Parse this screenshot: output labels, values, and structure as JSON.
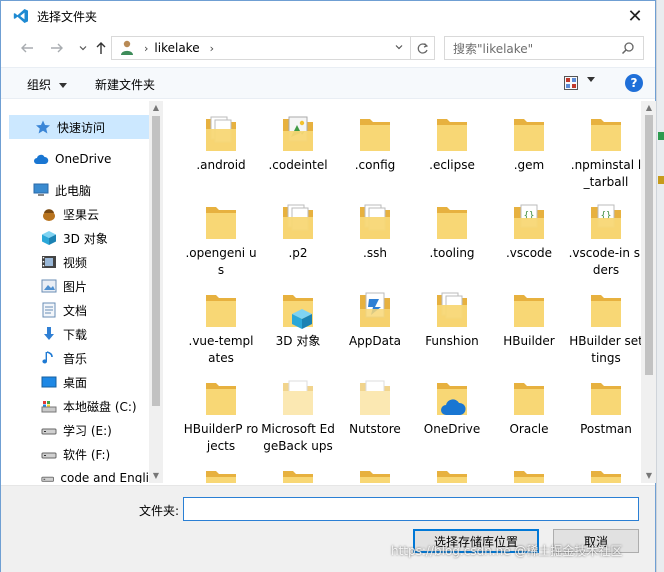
{
  "window": {
    "title": "选择文件夹",
    "close_glyph": "✕"
  },
  "address_bar": {
    "path_segment": "likelake",
    "search_placeholder": "搜索\"likelake\""
  },
  "toolbar": {
    "organize_label": "组织",
    "new_folder_label": "新建文件夹",
    "help_label": "?"
  },
  "nav_pane": {
    "items": [
      {
        "label": "快速访问",
        "icon": "star-icon"
      },
      {
        "label": "OneDrive",
        "icon": "cloud-icon"
      },
      {
        "label": "此电脑",
        "icon": "computer-icon"
      },
      {
        "label": "坚果云",
        "icon": "nut-icon"
      },
      {
        "label": "3D 对象",
        "icon": "cube-icon"
      },
      {
        "label": "视频",
        "icon": "video-icon"
      },
      {
        "label": "图片",
        "icon": "pictures-icon"
      },
      {
        "label": "文档",
        "icon": "document-icon"
      },
      {
        "label": "下载",
        "icon": "download-icon"
      },
      {
        "label": "音乐",
        "icon": "music-icon"
      },
      {
        "label": "桌面",
        "icon": "desktop-icon"
      },
      {
        "label": "本地磁盘 (C:)",
        "icon": "disk-icon"
      },
      {
        "label": "学习 (E:)",
        "icon": "drive-icon"
      },
      {
        "label": "软件 (F:)",
        "icon": "drive-icon"
      },
      {
        "label": "code and Engli",
        "icon": "drive-icon"
      }
    ]
  },
  "folders": [
    {
      "label": ".android",
      "icon": "folder-docs-icon"
    },
    {
      "label": ".codeintel",
      "icon": "folder-image-icon"
    },
    {
      "label": ".config",
      "icon": "folder-icon"
    },
    {
      "label": ".eclipse",
      "icon": "folder-icon"
    },
    {
      "label": ".gem",
      "icon": "folder-icon"
    },
    {
      "label": ".npminstal l_tarball",
      "icon": "folder-icon"
    },
    {
      "label": ".opengeni us",
      "icon": "folder-icon"
    },
    {
      "label": ".p2",
      "icon": "folder-docs-icon"
    },
    {
      "label": ".ssh",
      "icon": "folder-docs-icon"
    },
    {
      "label": ".tooling",
      "icon": "folder-icon"
    },
    {
      "label": ".vscode",
      "icon": "folder-code-icon"
    },
    {
      "label": ".vscode-in siders",
      "icon": "folder-code-icon"
    },
    {
      "label": ".vue-templ ates",
      "icon": "folder-icon"
    },
    {
      "label": "3D 对象",
      "icon": "folder-3d-icon"
    },
    {
      "label": "AppData",
      "icon": "folder-appdata-icon"
    },
    {
      "label": "Funshion",
      "icon": "folder-docs-icon"
    },
    {
      "label": "HBuilder",
      "icon": "folder-icon"
    },
    {
      "label": "HBuilder settings",
      "icon": "folder-icon"
    },
    {
      "label": "HBuilderP rojects",
      "icon": "folder-icon"
    },
    {
      "label": "Microsoft EdgeBack ups",
      "icon": "folder-light-icon"
    },
    {
      "label": "Nutstore",
      "icon": "folder-light-icon"
    },
    {
      "label": "OneDrive",
      "icon": "folder-onedrive-icon"
    },
    {
      "label": "Oracle",
      "icon": "folder-icon"
    },
    {
      "label": "Postman",
      "icon": "folder-icon"
    }
  ],
  "footer": {
    "folder_label": "文件夹:",
    "folder_value": "",
    "select_button": "选择存储库位置",
    "cancel_button": "取消",
    "watermark": "https://blog.csdn.ne @稀土掘金技术社区"
  },
  "colors": {
    "accent": "#0078d7",
    "selection": "#cce8ff",
    "folder": "#f4c95d",
    "toolbar_bg": "#f6f9fc",
    "footer_bg": "#f0f0f0"
  }
}
